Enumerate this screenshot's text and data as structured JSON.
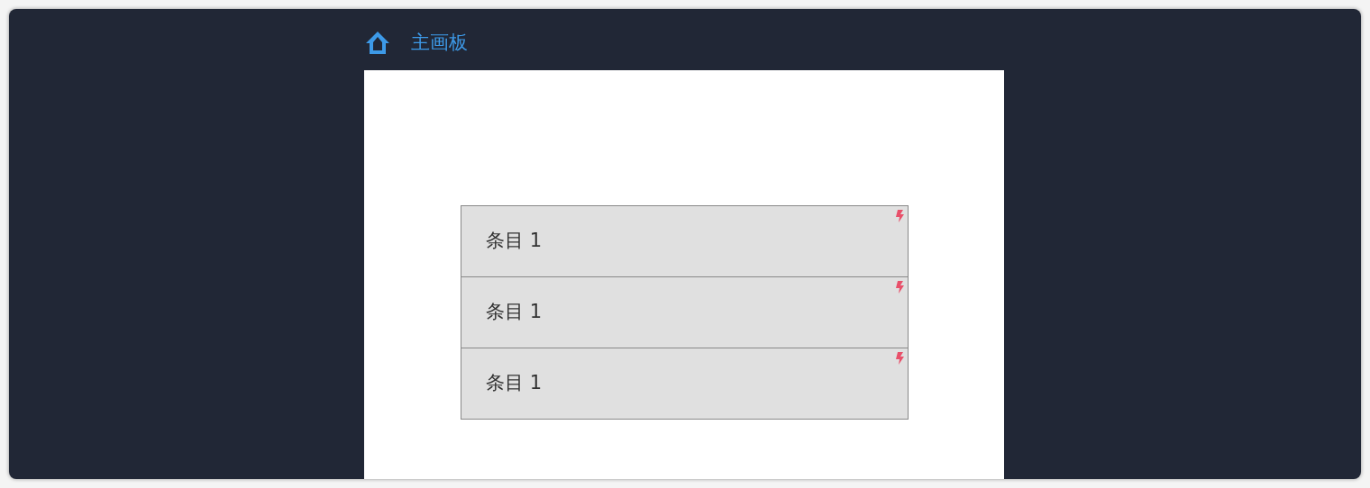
{
  "header": {
    "title": "主画板"
  },
  "list": {
    "items": [
      {
        "label": "条目 1"
      },
      {
        "label": "条目 1"
      },
      {
        "label": "条目 1"
      }
    ]
  }
}
